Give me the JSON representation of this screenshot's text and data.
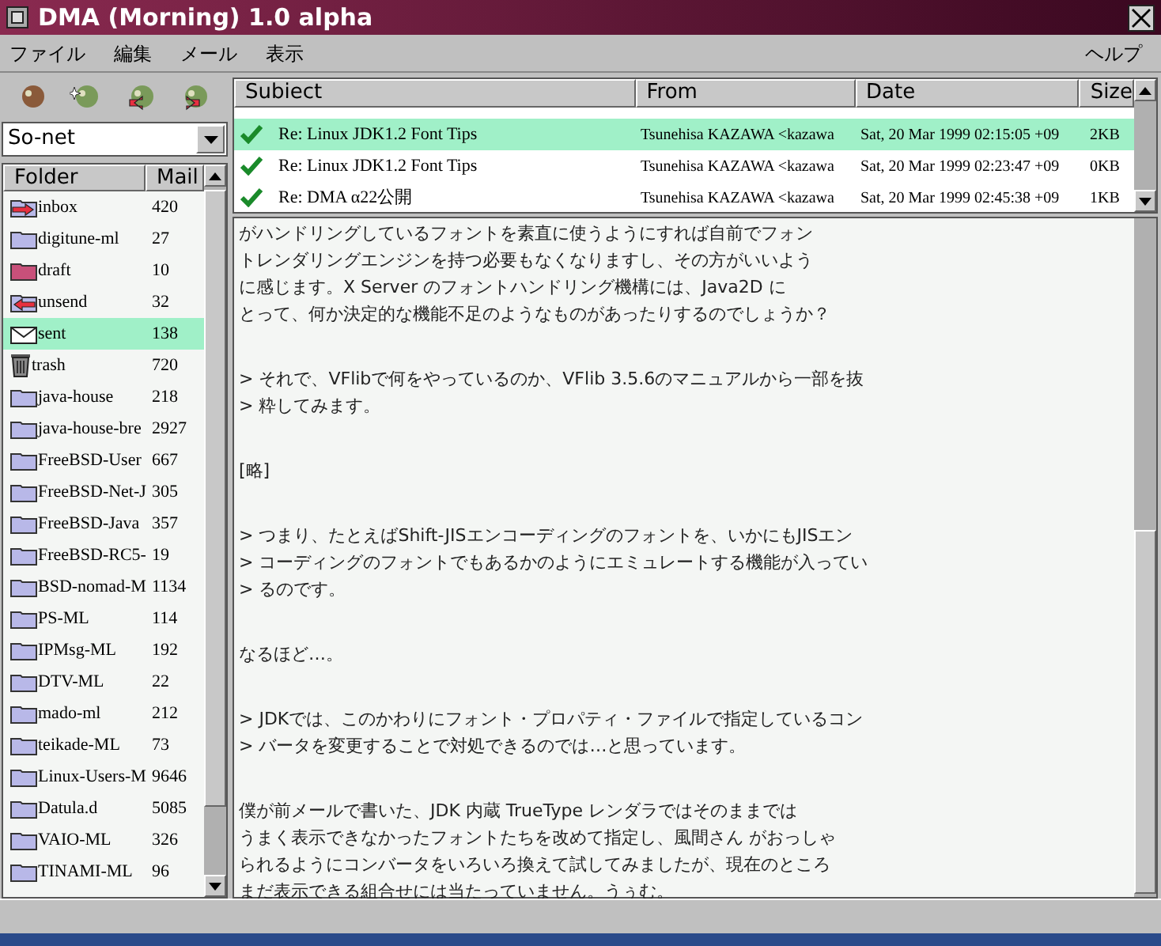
{
  "window": {
    "title": "DMA (Morning) 1.0 alpha"
  },
  "menu": [
    {
      "label": "ファイル"
    },
    {
      "label": "編集"
    },
    {
      "label": "メール"
    },
    {
      "label": "表示"
    }
  ],
  "help_menu": {
    "label": "ヘルプ"
  },
  "account": {
    "value": "So-net"
  },
  "folder_columns": [
    "Folder",
    "Mail"
  ],
  "folders": [
    {
      "kind": "inbox",
      "name": "inbox",
      "count": "420",
      "selected": false
    },
    {
      "kind": "folder",
      "name": "digitune-ml",
      "count": "27",
      "selected": false
    },
    {
      "kind": "draft",
      "name": "draft",
      "count": "10",
      "selected": false
    },
    {
      "kind": "unsend",
      "name": "unsend",
      "count": "32",
      "selected": false
    },
    {
      "kind": "sent",
      "name": "sent",
      "count": "138",
      "selected": true
    },
    {
      "kind": "trash",
      "name": "trash",
      "count": "720",
      "selected": false
    },
    {
      "kind": "folder",
      "name": "java-house",
      "count": "218",
      "selected": false
    },
    {
      "kind": "folder",
      "name": "java-house-bre",
      "count": "2927",
      "selected": false
    },
    {
      "kind": "folder",
      "name": "FreeBSD-User",
      "count": "667",
      "selected": false
    },
    {
      "kind": "folder",
      "name": "FreeBSD-Net-J",
      "count": "305",
      "selected": false
    },
    {
      "kind": "folder",
      "name": "FreeBSD-Java",
      "count": "357",
      "selected": false
    },
    {
      "kind": "folder",
      "name": "FreeBSD-RC5-",
      "count": "19",
      "selected": false
    },
    {
      "kind": "folder",
      "name": "BSD-nomad-M",
      "count": "1134",
      "selected": false
    },
    {
      "kind": "folder",
      "name": "PS-ML",
      "count": "114",
      "selected": false
    },
    {
      "kind": "folder",
      "name": "IPMsg-ML",
      "count": "192",
      "selected": false
    },
    {
      "kind": "folder",
      "name": "DTV-ML",
      "count": "22",
      "selected": false
    },
    {
      "kind": "folder",
      "name": "mado-ml",
      "count": "212",
      "selected": false
    },
    {
      "kind": "folder",
      "name": "teikade-ML",
      "count": "73",
      "selected": false
    },
    {
      "kind": "folder",
      "name": "Linux-Users-M",
      "count": "9646",
      "selected": false
    },
    {
      "kind": "folder",
      "name": "Datula.d",
      "count": "5085",
      "selected": false
    },
    {
      "kind": "folder",
      "name": "VAIO-ML",
      "count": "326",
      "selected": false
    },
    {
      "kind": "folder",
      "name": "TINAMI-ML",
      "count": "96",
      "selected": false
    }
  ],
  "message_columns": [
    "Subiect",
    "From",
    "Date",
    "Size"
  ],
  "messages": [
    {
      "read": true,
      "subject": "Re: Linux JDK1.2 Font Tips",
      "from": "Tsunehisa KAZAWA <kazawa",
      "date": "Sat, 20 Mar 1999 02:15:05 +09",
      "size": "2KB",
      "selected": true
    },
    {
      "read": true,
      "subject": "Re: Linux JDK1.2 Font Tips",
      "from": "Tsunehisa KAZAWA <kazawa",
      "date": "Sat, 20 Mar 1999 02:23:47 +09",
      "size": "0KB",
      "selected": false
    },
    {
      "read": true,
      "subject": "Re: DMA α22公開",
      "from": "Tsunehisa KAZAWA <kazawa",
      "date": "Sat, 20 Mar 1999 02:45:38 +09",
      "size": "1KB",
      "selected": false
    }
  ],
  "body": [
    [
      "がハンドリングしているフォントを素直に使うようにすれば自前でフォン",
      "トレンダリングエンジンを持つ必要もなくなりますし、その方がいいよう",
      "に感じます。X Server のフォントハンドリング機構には、Java2D に",
      "とって、何か決定的な機能不足のようなものがあったりするのでしょうか？"
    ],
    [
      "> それで、VFlibで何をやっているのか、VFlib 3.5.6のマニュアルから一部を抜",
      "> 粋してみます。"
    ],
    [
      "[略]"
    ],
    [
      "> つまり、たとえばShift-JISエンコーディングのフォントを、いかにもJISエン",
      "> コーディングのフォントでもあるかのようにエミュレートする機能が入ってい",
      "> るのです。"
    ],
    [
      "なるほど…。"
    ],
    [
      "> JDKでは、このかわりにフォント・プロパティ・ファイルで指定しているコン",
      "> バータを変更することで対処できるのでは…と思っています。"
    ],
    [
      "僕が前メールで書いた、JDK 内蔵 TrueType レンダラではそのままでは",
      "うまく表示できなかったフォントたちを改めて指定し、風間さん がおっしゃ",
      "られるようにコンバータをいろいろ換えて試してみましたが、現在のところ",
      "まだ表示できる組合せには当たっていません。うぅむ。"
    ]
  ]
}
